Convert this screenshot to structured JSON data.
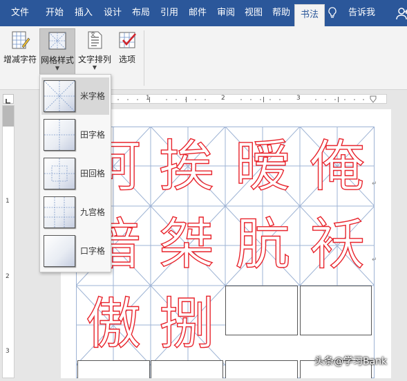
{
  "ribbon_tabs": [
    "文件",
    "开始",
    "插入",
    "设计",
    "布局",
    "引用",
    "邮件",
    "审阅",
    "视图",
    "帮助",
    "书法",
    "告诉我"
  ],
  "active_tab": "书法",
  "ribbon_buttons": {
    "add_remove_chars": "增减字符",
    "grid_style": "网格样式",
    "text_arrange": "文字排列",
    "options": "选项"
  },
  "ruler": {
    "marks": [
      "1",
      "2",
      "3"
    ],
    "vmarks": [
      "1",
      "2",
      "3"
    ]
  },
  "grid_style_menu": [
    {
      "label": "米字格",
      "selected": true
    },
    {
      "label": "田字格",
      "selected": false
    },
    {
      "label": "田回格",
      "selected": false
    },
    {
      "label": "九宫格",
      "selected": false
    },
    {
      "label": "口字格",
      "selected": false
    }
  ],
  "calligraphy_chars": {
    "row1": [
      "阿",
      "挨",
      "暧",
      "俺"
    ],
    "row2": [
      "谙",
      "桀",
      "肮",
      "袄"
    ],
    "row3": [
      "傲",
      "捌"
    ]
  },
  "colors": {
    "tab_bar": "#2b579a",
    "char_outline": "#e8242c",
    "grid_line": "#9db3d4"
  },
  "watermark": "头条@学习Bank"
}
